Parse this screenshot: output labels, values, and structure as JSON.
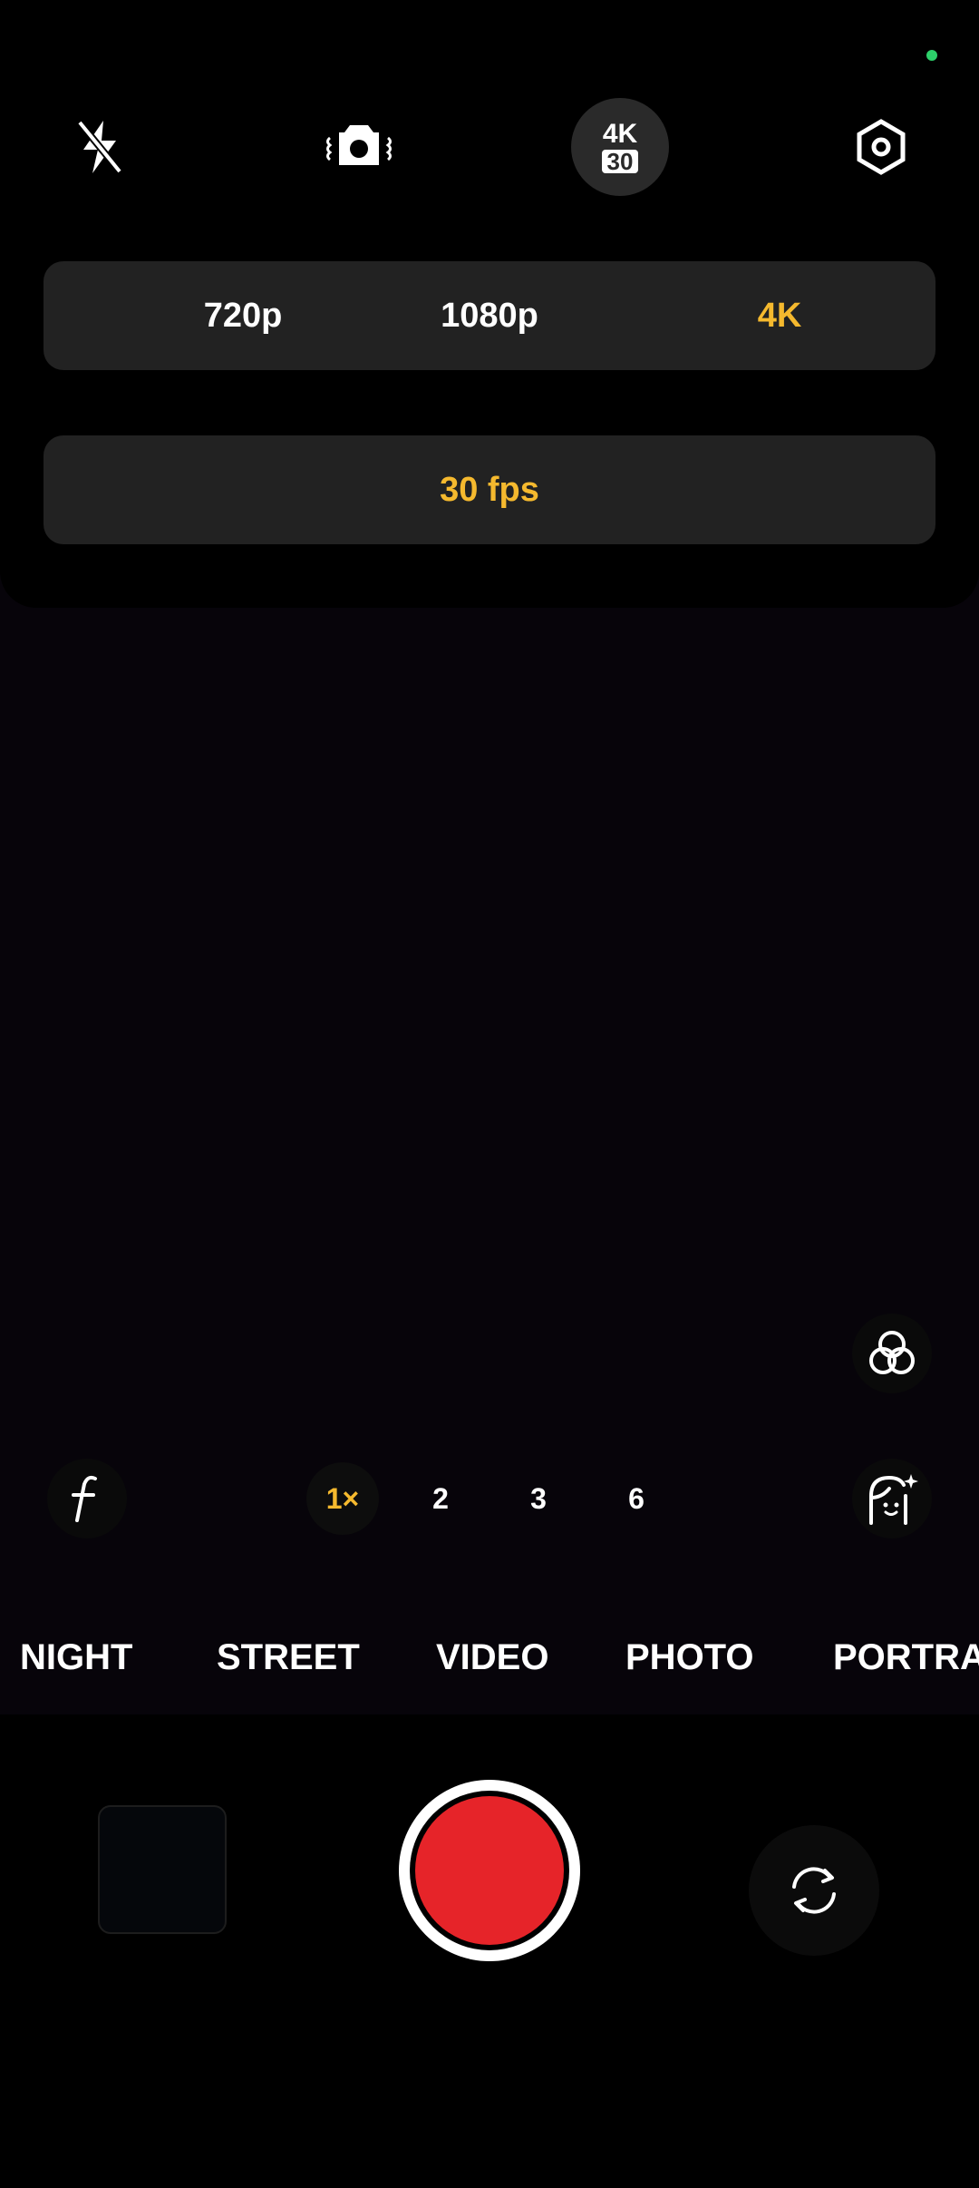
{
  "top_bar": {
    "icons": [
      "flash-off-icon",
      "stabilization-camera-icon",
      "resolution-badge",
      "settings-hexagon-icon"
    ],
    "badge_line1": "4K",
    "badge_line2": "30"
  },
  "resolution": {
    "options": [
      "720p",
      "1080p",
      "4K"
    ],
    "selected": "4K"
  },
  "fps": {
    "label": "30 fps"
  },
  "side_controls": {
    "filter_icon": "filters-circles-icon",
    "aperture_icon": "f-stop-icon",
    "beauty_icon": "face-retouch-icon"
  },
  "zoom": {
    "levels": [
      "1×",
      "2",
      "3",
      "6"
    ],
    "selected": "1×"
  },
  "modes": {
    "items": [
      "NIGHT",
      "STREET",
      "VIDEO",
      "PHOTO",
      "PORTRA"
    ],
    "selected": "VIDEO"
  },
  "controls": {
    "shutter_icon": "record-button",
    "switch_icon": "switch-camera-icon"
  },
  "colors": {
    "accent": "#f5b92e",
    "record": "#e62429",
    "status_dot": "#2dd06a"
  }
}
